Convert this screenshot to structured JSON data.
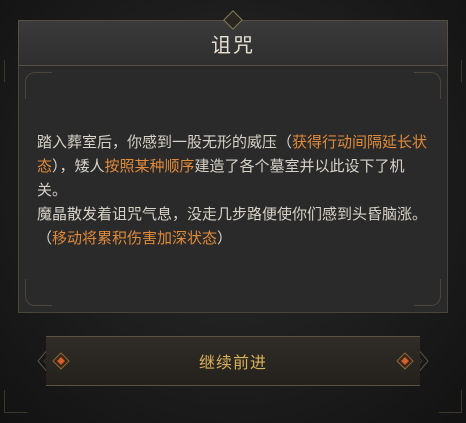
{
  "dialog": {
    "title": "诅咒",
    "paragraph1": {
      "seg1": "踏入葬室后，你感到一股无形的威压（",
      "seg2_highlight": "获得行动间隔延长状态",
      "seg3": "），矮人",
      "seg4_highlight": "按照某种顺序",
      "seg5": "建造了各个墓室并以此设下了机关。"
    },
    "paragraph2": {
      "seg1": "魔晶散发着诅咒气息，没走几步路便使你们感到头昏脑涨。（",
      "seg2_highlight": "移动将累积伤害加深状态",
      "seg3": "）"
    },
    "continue_label": "继续前进"
  },
  "colors": {
    "highlight": "#e08a3a",
    "body_text": "#d7d2c7",
    "button_text": "#d9b15a",
    "gem": "#d0602a"
  },
  "icons": {
    "title_ornament": "diamond-ornament-icon",
    "left_gem": "gem-diamond-icon",
    "right_gem": "gem-diamond-icon"
  }
}
